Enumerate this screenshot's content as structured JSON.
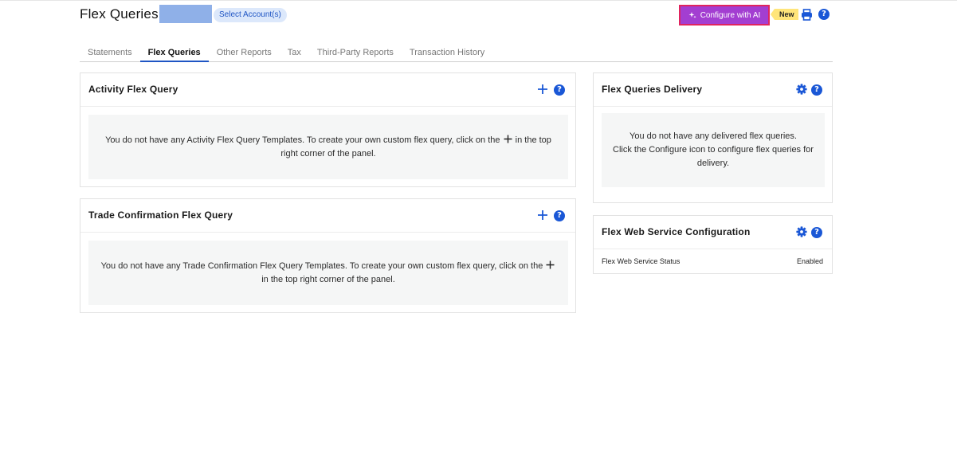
{
  "header": {
    "title": "Flex Queries",
    "select_account_label": "Select Account(s)",
    "ai_button_label": "Configure with AI",
    "new_badge": "New"
  },
  "tabs": [
    {
      "label": "Statements",
      "active": false
    },
    {
      "label": "Flex Queries",
      "active": true
    },
    {
      "label": "Other Reports",
      "active": false
    },
    {
      "label": "Tax",
      "active": false
    },
    {
      "label": "Third-Party Reports",
      "active": false
    },
    {
      "label": "Transaction History",
      "active": false
    }
  ],
  "panels": {
    "activity": {
      "title": "Activity Flex Query",
      "empty_before": "You do not have any Activity Flex Query Templates. To create your own custom flex query, click on the",
      "empty_after": "in the top right corner of the panel."
    },
    "trade": {
      "title": "Trade Confirmation Flex Query",
      "empty_before": "You do not have any Trade Confirmation Flex Query Templates. To create your own custom flex query, click on the",
      "empty_after": "in the top right corner of the panel."
    },
    "delivery": {
      "title": "Flex Queries Delivery",
      "empty_line1": "You do not have any delivered flex queries.",
      "empty_line2": "Click the Configure icon to configure flex queries for delivery."
    },
    "web_service": {
      "title": "Flex Web Service Configuration",
      "status_label": "Flex Web Service Status",
      "status_value": "Enabled"
    }
  },
  "icons": {
    "help_glyph": "?",
    "sparkle": "sparkle-icon",
    "print": "print-icon",
    "plus": "plus-icon",
    "gear": "gear-icon"
  },
  "colors": {
    "accent_blue": "#1a57d6",
    "ai_purple": "#a33ed1",
    "ai_border": "#e0245e",
    "badge_yellow": "#ffe57a"
  }
}
